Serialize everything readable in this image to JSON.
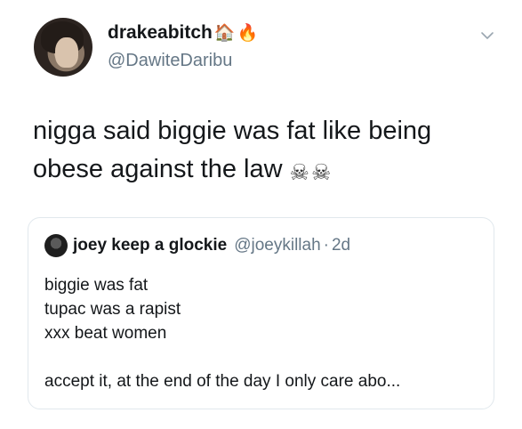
{
  "author": {
    "display_name": "drakeabitch",
    "emojis": [
      "🏠",
      "🔥"
    ],
    "handle": "@DawiteDaribu"
  },
  "icons": {
    "chevron": "chevron-down-icon",
    "skull": "skull-and-crossbones-icon"
  },
  "tweet": {
    "lines": [
      "nigga said biggie was fat like being",
      "obese against the law"
    ],
    "emoji": "☠☠"
  },
  "quoted_tweet": {
    "display_name": "joey keep a glockie",
    "handle": "@joeykillah",
    "separator": "·",
    "time": "2d",
    "lines": [
      "biggie was fat",
      "tupac was a rapist",
      "xxx beat women",
      "",
      "accept it, at the end of the day I only care abo..."
    ]
  },
  "colors": {
    "text": "#14171a",
    "secondary": "#657786",
    "border": "#e1e8ed"
  }
}
